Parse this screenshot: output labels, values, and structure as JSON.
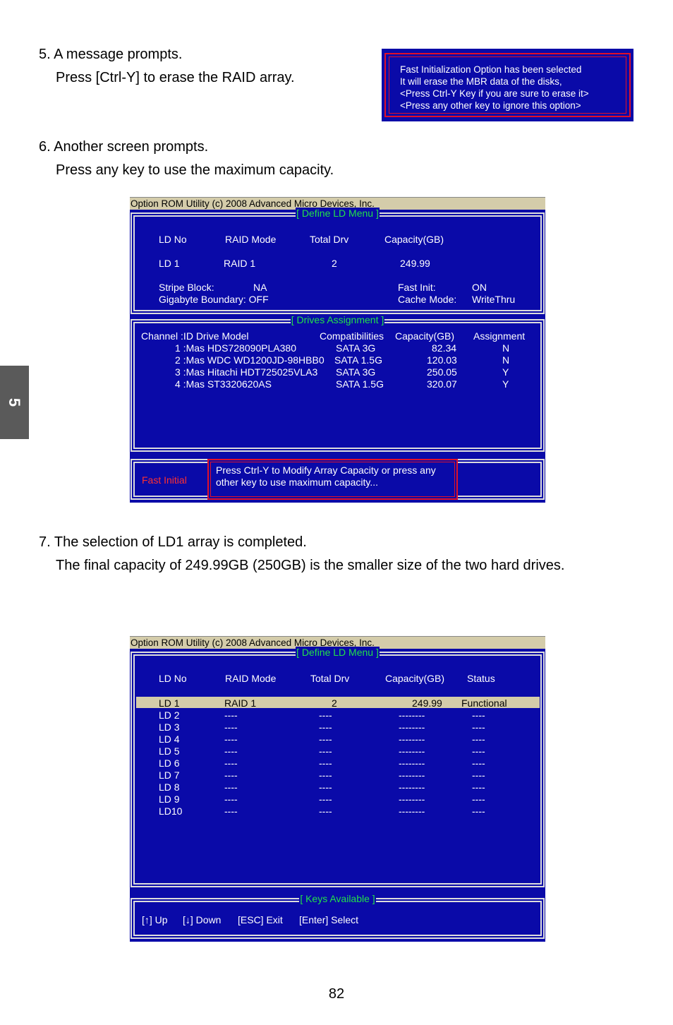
{
  "steps": {
    "s5": {
      "line1": "5. A message prompts.",
      "line2": "Press [Ctrl-Y] to erase the RAID array."
    },
    "s6": {
      "line1": "6. Another screen prompts.",
      "line2": "Press any key to use the maximum capacity."
    },
    "s7": {
      "line1": "7. The selection of LD1 array is completed.",
      "line2": "The final capacity of 249.99GB (250GB) is the smaller size of the two hard drives."
    }
  },
  "side_tab": "5",
  "page_number": "82",
  "message_box": {
    "lines": [
      "Fast Initialization Option has been selected",
      "It will erase the MBR data of the disks,",
      "<Press Ctrl-Y Key if you are sure to erase it>",
      "<Press any other key to ignore this option>"
    ]
  },
  "screen1": {
    "title": "Option ROM Utility (c) 2008 Advanced Micro Devices, Inc.",
    "ld_menu_title": "[ Define LD Menu ]",
    "headers": {
      "ld_no": "LD No",
      "raid_mode": "RAID Mode",
      "total_drv": "Total Drv",
      "capacity": "Capacity(GB)"
    },
    "row": {
      "ld_no": "LD  1",
      "raid_mode": "RAID 1",
      "total_drv": "2",
      "capacity": "249.99"
    },
    "stripe_block_label": "Stripe Block:",
    "stripe_block_value": "NA",
    "gigabyte_boundary": "Gigabyte Boundary: OFF",
    "fast_init_label": "Fast Init:",
    "fast_init_value": "ON",
    "cache_mode_label": "Cache Mode:",
    "cache_mode_value": "WriteThru",
    "drives_title": "[ Drives Assignment ]",
    "drive_headers": {
      "channel": "Channel  :ID   Drive Model",
      "compat": "Compatibilities",
      "capacity": "Capacity(GB)",
      "assignment": "Assignment"
    },
    "drives": [
      {
        "id": "1 :Mas HDS728090PLA380",
        "compat": "SATA  3G",
        "capacity": "82.34",
        "assign": "N"
      },
      {
        "id": "2 :Mas WDC WD1200JD-98HBB0",
        "compat": "SATA  1.5G",
        "capacity": "120.03",
        "assign": "N"
      },
      {
        "id": "3 :Mas Hitachi HDT725025VLA3",
        "compat": "SATA  3G",
        "capacity": "250.05",
        "assign": "Y"
      },
      {
        "id": "4 :Mas ST3320620AS",
        "compat": "SATA  1.5G",
        "capacity": "320.07",
        "assign": "Y"
      }
    ],
    "fast_initial": "Fast Initial",
    "prompt_line1": "Press Ctrl-Y to Modify Array Capacity or press any",
    "prompt_line2": "other key to use maximum capacity..."
  },
  "screen2": {
    "title": "Option ROM Utility (c) 2008 Advanced Micro Devices, Inc.",
    "ld_menu_title": "[ Define LD Menu ]",
    "headers": {
      "ld_no": "LD No",
      "raid_mode": "RAID Mode",
      "total_drv": "Total Drv",
      "capacity": "Capacity(GB)",
      "status": "Status"
    },
    "rows": [
      {
        "ld": "LD  1",
        "mode": "RAID 1",
        "drv": "2",
        "cap": "249.99",
        "status": "Functional"
      },
      {
        "ld": "LD  2",
        "mode": "----",
        "drv": "----",
        "cap": "--------",
        "status": "----"
      },
      {
        "ld": "LD  3",
        "mode": "----",
        "drv": "----",
        "cap": "--------",
        "status": "----"
      },
      {
        "ld": "LD  4",
        "mode": "----",
        "drv": "----",
        "cap": "--------",
        "status": "----"
      },
      {
        "ld": "LD  5",
        "mode": "----",
        "drv": "----",
        "cap": "--------",
        "status": "----"
      },
      {
        "ld": "LD  6",
        "mode": "----",
        "drv": "----",
        "cap": "--------",
        "status": "----"
      },
      {
        "ld": "LD  7",
        "mode": "----",
        "drv": "----",
        "cap": "--------",
        "status": "----"
      },
      {
        "ld": "LD  8",
        "mode": "----",
        "drv": "----",
        "cap": "--------",
        "status": "----"
      },
      {
        "ld": "LD  9",
        "mode": "----",
        "drv": "----",
        "cap": "--------",
        "status": "----"
      },
      {
        "ld": "LD10",
        "mode": "----",
        "drv": "----",
        "cap": "--------",
        "status": "----"
      }
    ],
    "keys_title": "[ Keys Available ]",
    "keys": {
      "up": "[↑] Up",
      "down": "[↓] Down",
      "esc": "[ESC] Exit",
      "enter": "[Enter] Select"
    }
  }
}
